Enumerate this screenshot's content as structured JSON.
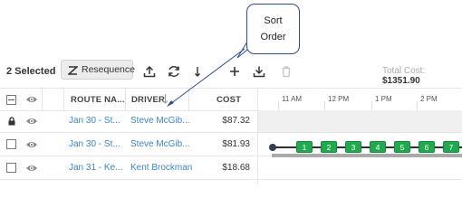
{
  "callout": {
    "line1": "Sort",
    "line2": "Order"
  },
  "toolbar": {
    "selected_label": "2 Selected",
    "resequence_label": "Resequence",
    "total_cost_label": "Total Cost:",
    "total_cost_value": "$1351.90"
  },
  "table": {
    "columns": {
      "route": "ROUTE NA...",
      "driver": "DRIVER",
      "cost": "COST"
    },
    "rows": [
      {
        "route": "Jan 30 - St...",
        "driver": "Steve McGib...",
        "cost": "$87.32",
        "locked": true
      },
      {
        "route": "Jan 30 - St...",
        "driver": "Steve McGib...",
        "cost": "$81.93",
        "locked": false
      },
      {
        "route": "Jan 31 - Ke...",
        "driver": "Kent Brockman",
        "cost": "$18.68",
        "locked": false
      }
    ]
  },
  "timeline": {
    "labels": [
      "11 AM",
      "12 PM",
      "1 PM",
      "2 PM"
    ]
  },
  "stops": [
    "1",
    "2",
    "3",
    "4",
    "5",
    "6",
    "7"
  ],
  "colors": {
    "link": "#3d85c6",
    "stop_green": "#21a94f",
    "callout_border": "#2e4e8c"
  }
}
